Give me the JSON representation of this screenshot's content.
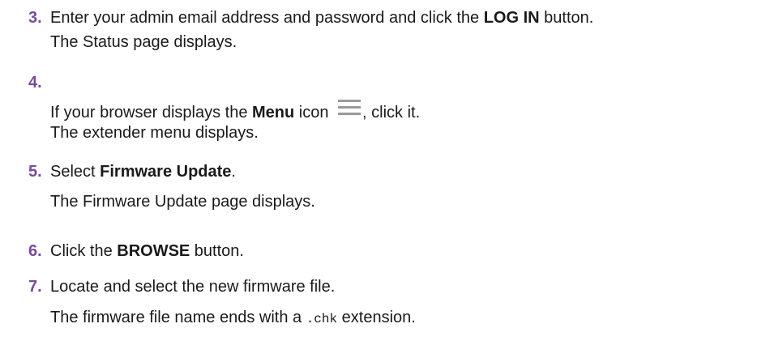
{
  "steps": [
    {
      "number": "3.",
      "line1_a": "Enter your admin email address and password and click the ",
      "line1_bold": "LOG IN",
      "line1_b": " button.",
      "line2": "The Status page displays."
    },
    {
      "number": "4.",
      "line1_a": "If your browser displays the ",
      "line1_bold": "Menu",
      "line1_b": " icon ",
      "icon": "hamburger-menu-icon",
      "line1_c": ", click it.",
      "line2": "The extender menu displays."
    },
    {
      "number": "5.",
      "line1_a": "Select ",
      "line1_bold": "Firmware Update",
      "line1_b": ".",
      "line2": "The Firmware Update page displays."
    },
    {
      "number": "6.",
      "line1_a": "Click the ",
      "line1_bold": "BROWSE",
      "line1_b": " button."
    },
    {
      "number": "7.",
      "line1_a": "Locate and select the new firmware file.",
      "line2_a": "The firmware file name ends with a ",
      "line2_code": ".chk",
      "line2_b": " extension."
    }
  ],
  "colors": {
    "step_number": "#7a4a9e",
    "text": "#1a1a1a",
    "icon": "#9a9a9a"
  }
}
